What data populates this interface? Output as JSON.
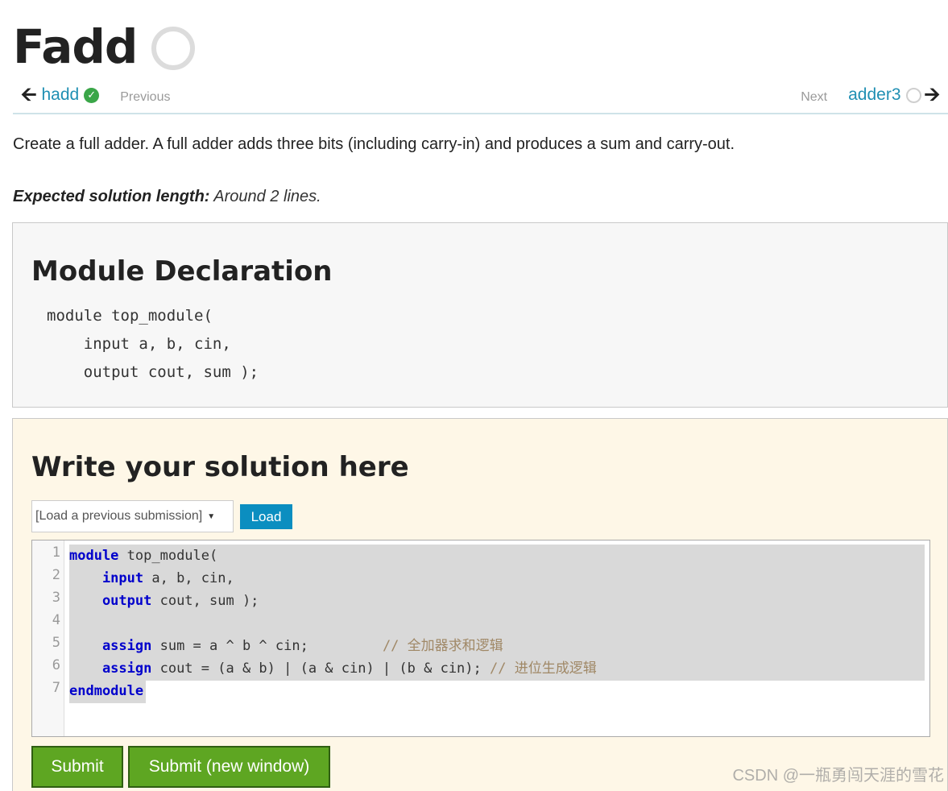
{
  "page": {
    "title": "Fadd"
  },
  "nav": {
    "prev_link": "hadd",
    "prev_label": "Previous",
    "next_label": "Next",
    "next_link": "adder3"
  },
  "problem": {
    "description": "Create a full adder. A full adder adds three bits (including carry-in) and produces a sum and carry-out.",
    "expected_label": "Expected solution length:",
    "expected_value": " Around 2 lines."
  },
  "declaration": {
    "heading": "Module Declaration",
    "code": "module top_module(\n    input a, b, cin,\n    output cout, sum );"
  },
  "solution": {
    "heading": "Write your solution here",
    "load_select_value": "[Load a previous submission]",
    "load_button": "Load",
    "line_numbers": [
      "1",
      "2",
      "3",
      "4",
      "5",
      "6",
      "7"
    ],
    "code_lines": [
      {
        "kw": "module",
        "rest": " top_module(",
        "comment": ""
      },
      {
        "kw": "    input",
        "rest": " a, b, cin,",
        "comment": ""
      },
      {
        "kw": "    output",
        "rest": " cout, sum );",
        "comment": ""
      },
      {
        "kw": "",
        "rest": "",
        "comment": ""
      },
      {
        "kw": "    assign",
        "rest": " sum = a ^ b ^ cin;         ",
        "comment": "// 全加器求和逻辑"
      },
      {
        "kw": "    assign",
        "rest": " cout = (a & b) | (a & cin) | (b & cin); ",
        "comment": "// 进位生成逻辑"
      },
      {
        "kw": "endmodule",
        "rest": "",
        "comment": ""
      }
    ],
    "submit_button": "Submit",
    "submit_new_window_button": "Submit (new window)"
  },
  "watermark": "CSDN @一瓶勇闯天涯的雪花",
  "colors": {
    "link": "#1f8fb3",
    "done": "#3aa648",
    "keyword": "#0000cc",
    "comment": "#a08866",
    "submit": "#5ea622",
    "load": "#0b8ec0"
  },
  "icons": {
    "title_status": "empty-circle-icon",
    "prev_status": "check-circle-icon",
    "next_status": "empty-circle-icon"
  }
}
